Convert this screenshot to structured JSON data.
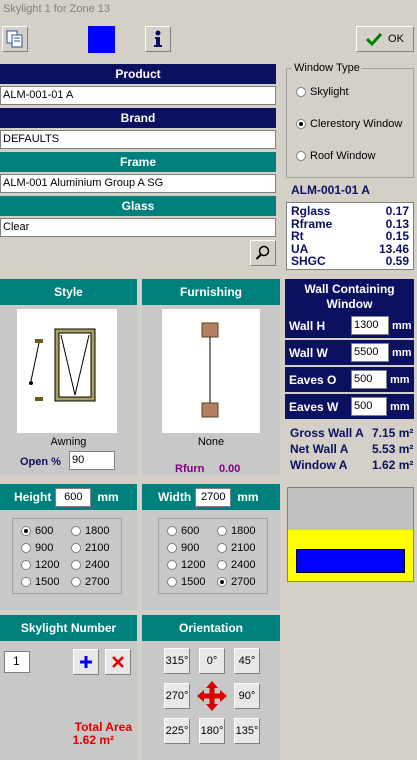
{
  "window": {
    "title": "Skylight 1 for Zone 13"
  },
  "toolbar": {
    "ok_label": "OK"
  },
  "product": {
    "product_label": "Product",
    "product_value": "ALM-001-01 A",
    "brand_label": "Brand",
    "brand_value": "DEFAULTS",
    "frame_label": "Frame",
    "frame_value": "ALM-001 Aluminium Group A SG",
    "glass_label": "Glass",
    "glass_value": "Clear"
  },
  "window_type": {
    "legend": "Window Type",
    "options": [
      "Skylight",
      "Clerestory Window",
      "Roof Window"
    ],
    "selected": "Clerestory Window"
  },
  "properties": {
    "code": "ALM-001-01 A",
    "rows": [
      {
        "label": "Rglass",
        "value": "0.17"
      },
      {
        "label": "Rframe",
        "value": "0.13"
      },
      {
        "label": "Rt",
        "value": "0.15"
      },
      {
        "label": "UA",
        "value": "13.46"
      },
      {
        "label": "SHGC",
        "value": "0.59"
      }
    ]
  },
  "style": {
    "title": "Style",
    "name": "Awning",
    "open_label": "Open %",
    "open_value": "90"
  },
  "furnishing": {
    "title": "Furnishing",
    "name": "None",
    "rfurn_label": "Rfurn",
    "rfurn_value": "0.00"
  },
  "wall": {
    "title": "Wall Containing Window",
    "wall_h_label": "Wall H",
    "wall_h": "1300",
    "wall_w_label": "Wall W",
    "wall_w": "5500",
    "eaves_o_label": "Eaves O",
    "eaves_o": "500",
    "eaves_w_label": "Eaves W",
    "eaves_w": "500",
    "unit": "mm",
    "gross_label": "Gross Wall A",
    "gross_value": "7.15 m²",
    "net_label": "Net Wall A",
    "net_value": "5.53 m²",
    "window_label": "Window A",
    "window_value": "1.62 m²"
  },
  "height": {
    "label": "Height",
    "value": "600",
    "unit": "mm",
    "options": [
      "600",
      "1800",
      "900",
      "2100",
      "1200",
      "2400",
      "1500",
      "2700"
    ],
    "selected": "600"
  },
  "width": {
    "label": "Width",
    "value": "2700",
    "unit": "mm",
    "options": [
      "600",
      "1800",
      "900",
      "2100",
      "1200",
      "2400",
      "1500",
      "2700"
    ],
    "selected": "2700"
  },
  "skylight_number": {
    "title": "Skylight Number",
    "value": "1",
    "total_label": "Total Area",
    "total_value": "1.62 m²"
  },
  "orientation": {
    "title": "Orientation",
    "buttons": [
      "315°",
      "0°",
      "45°",
      "270°",
      "90°",
      "225°",
      "180°",
      "135°"
    ]
  },
  "colors": {
    "navy": "#0b1060",
    "teal": "#00807c",
    "blue": "#0000ff",
    "red": "#e00000",
    "yellow": "#ffff00",
    "purple": "#800080"
  }
}
